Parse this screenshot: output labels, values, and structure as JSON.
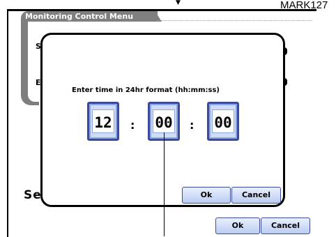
{
  "annotation": {
    "label": "MARK127",
    "marker": "▼"
  },
  "menu": {
    "title": "Monitoring Control Menu",
    "row_labels": {
      "start": "S",
      "end": "E",
      "bottom": "Se"
    }
  },
  "dialog": {
    "prompt": "Enter time in 24hr format (hh:mm:ss)",
    "hours": "12",
    "minutes": "00",
    "seconds": "00",
    "separator": ":",
    "ok_label": "Ok",
    "cancel_label": "Cancel"
  },
  "footer": {
    "ok_label": "Ok",
    "cancel_label": "Cancel"
  },
  "colors": {
    "button_border": "#3b4b9b",
    "field_fill": "#cfdcf8",
    "tab_gray": "#7f7f7f"
  }
}
